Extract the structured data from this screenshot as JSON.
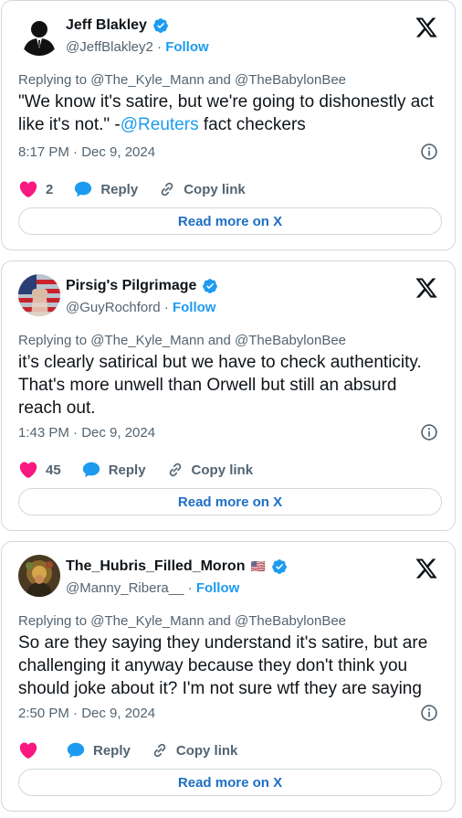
{
  "colors": {
    "link": "#1d9bf0",
    "like": "#f91880",
    "muted": "#536471",
    "border": "#cfd9de"
  },
  "tweets": [
    {
      "name": "Jeff Blakley",
      "handle": "@JeffBlakley2",
      "separator": " · ",
      "follow": "Follow",
      "reply_to": "Replying to @The_Kyle_Mann and @TheBabylonBee",
      "text_before": "\"We know it's satire, but we're going to dishonestly act like it's not.\" -",
      "mention": "@Reuters",
      "text_after": " fact checkers",
      "timestamp": "8:17 PM · Dec 9, 2024",
      "like_count": "2",
      "reply_label": "Reply",
      "copy_label": "Copy link",
      "readmore_label": "Read more on X",
      "avatar_icon": "silhouette-avatar"
    },
    {
      "name": "Pirsig's Pilgrimage",
      "handle": "@GuyRochford",
      "separator": " · ",
      "follow": "Follow",
      "reply_to": "Replying to @The_Kyle_Mann and @TheBabylonBee",
      "text": "it’s clearly satirical but we have to check authenticity. That's more unwell than Orwell but still an absurd reach out.",
      "timestamp": "1:43 PM · Dec 9, 2024",
      "like_count": "45",
      "reply_label": "Reply",
      "copy_label": "Copy link",
      "readmore_label": "Read more on X",
      "avatar_icon": "flag-fist-avatar"
    },
    {
      "name": "The_Hubris_Filled_Moron",
      "flag": "🇺🇸",
      "handle": "@Manny_Ribera__",
      "separator": " · ",
      "follow": "Follow",
      "reply_to": "Replying to @The_Kyle_Mann and @TheBabylonBee",
      "text": "So are they saying they understand it's satire, but are challenging it anyway because they don't think you should joke about it? I'm not sure wtf they are saying",
      "timestamp": "2:50 PM · Dec 9, 2024",
      "like_count": "",
      "reply_label": "Reply",
      "copy_label": "Copy link",
      "readmore_label": "Read more on X",
      "avatar_icon": "painting-avatar"
    }
  ]
}
